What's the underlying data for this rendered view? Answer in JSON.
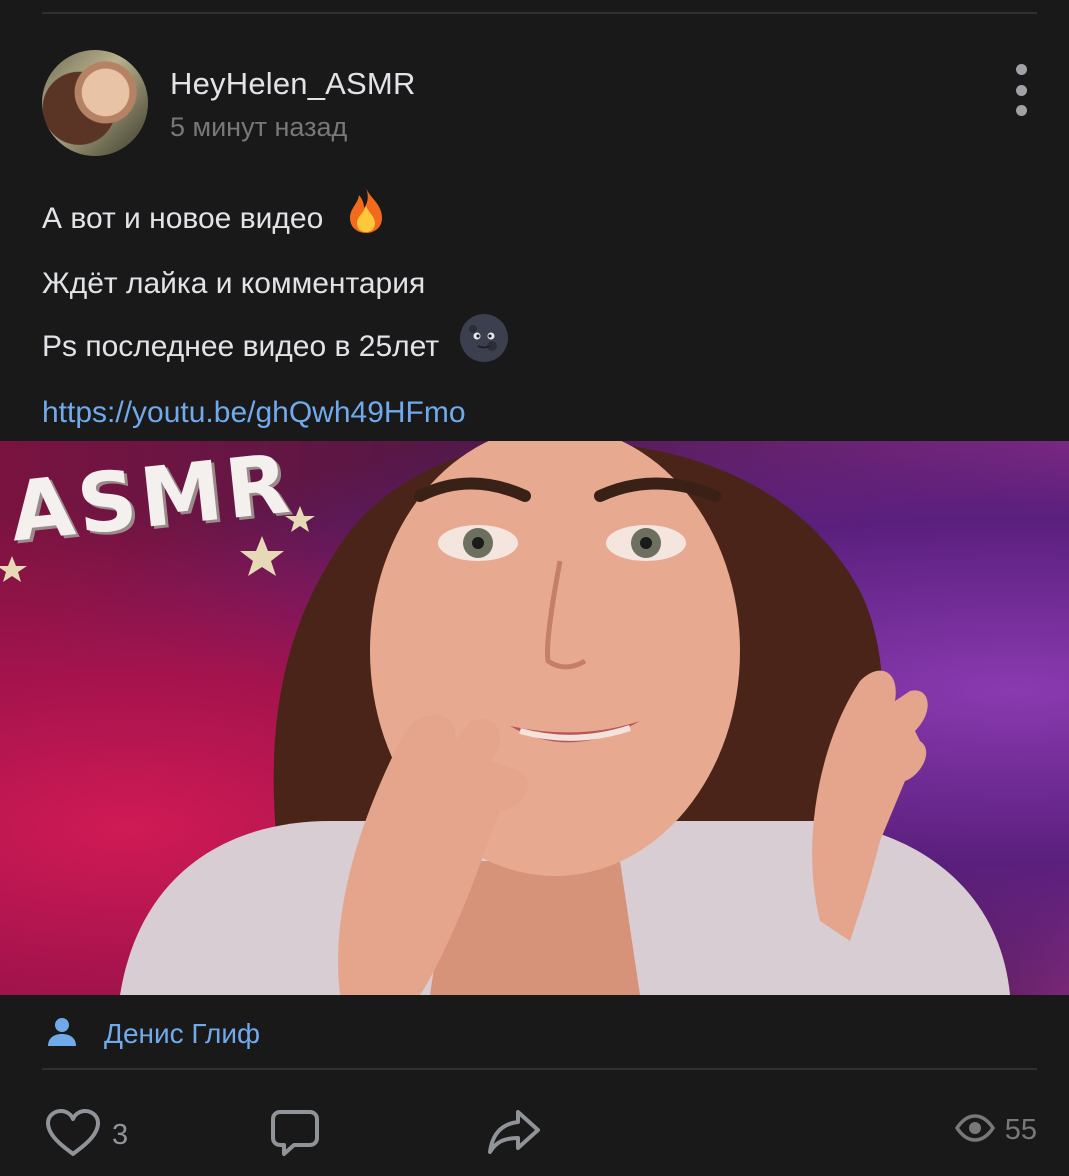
{
  "post": {
    "author": "HeyHelen_ASMR",
    "time": "5 минут назад",
    "lines": [
      "А вот и новое видео",
      "Ждёт лайка и комментария",
      "Ps последнее видео в 25лет"
    ],
    "link": "https://youtu.be/ghQwh49HFmo",
    "media_text": "ASMR",
    "signer": "Денис Глиф",
    "likes": "3",
    "views": "55"
  },
  "icons": {
    "fire": "fire-emoji",
    "moon": "new-moon-face-emoji",
    "more": "more-vertical-icon",
    "user": "user-icon",
    "like": "heart-icon",
    "comment": "comment-icon",
    "share": "share-icon",
    "views": "eye-icon"
  },
  "colors": {
    "background": "#19191a",
    "link": "#71aaeb",
    "text": "#e1e3e6",
    "muted": "#76787a"
  }
}
